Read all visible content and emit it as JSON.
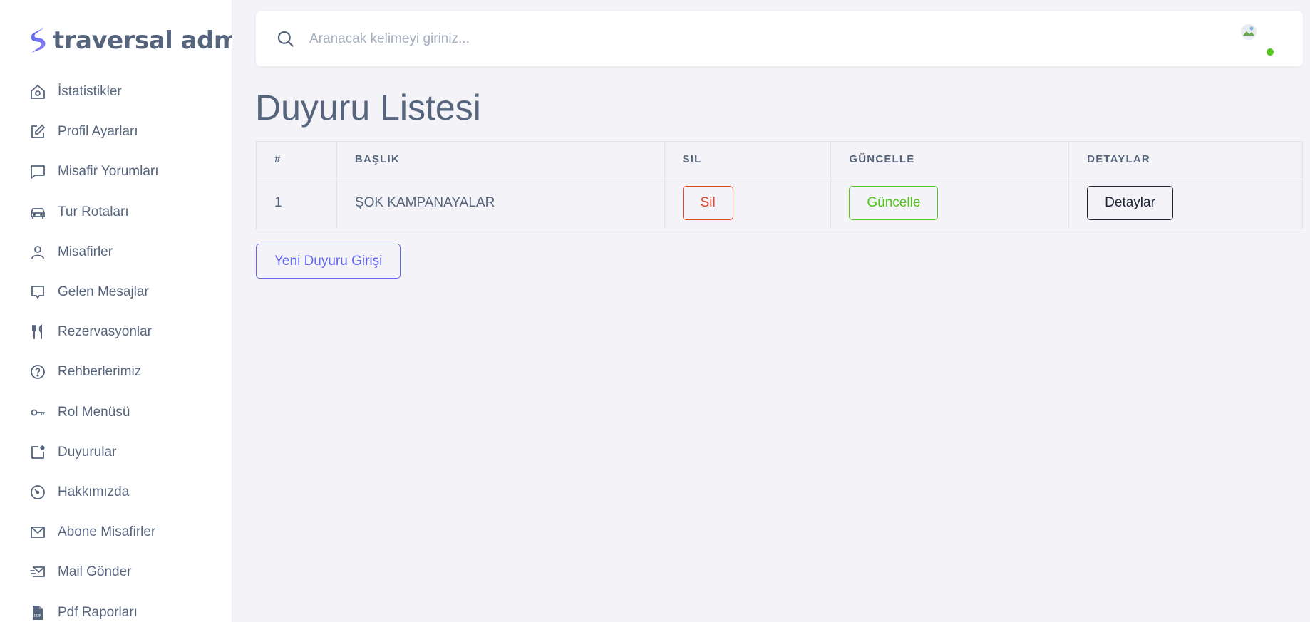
{
  "brand": {
    "name": "traversal admin"
  },
  "sidebar": {
    "items": [
      {
        "label": "İstatistikler",
        "icon": "home-icon"
      },
      {
        "label": "Profil Ayarları",
        "icon": "edit-icon"
      },
      {
        "label": "Misafir Yorumları",
        "icon": "comment-icon"
      },
      {
        "label": "Tur Rotaları",
        "icon": "car-icon"
      },
      {
        "label": "Misafirler",
        "icon": "user-icon"
      },
      {
        "label": "Gelen Mesajlar",
        "icon": "message-icon"
      },
      {
        "label": "Rezervasyonlar",
        "icon": "utensils-icon"
      },
      {
        "label": "Rehberlerimiz",
        "icon": "help-circle-icon"
      },
      {
        "label": "Rol Menüsü",
        "icon": "key-icon"
      },
      {
        "label": "Duyurular",
        "icon": "notification-icon"
      },
      {
        "label": "Hakkımızda",
        "icon": "gauge-icon"
      },
      {
        "label": "Abone Misafirler",
        "icon": "mail-icon"
      },
      {
        "label": "Mail Gönder",
        "icon": "mail-send-icon"
      },
      {
        "label": "Pdf Raporları",
        "icon": "pdf-file-icon"
      }
    ]
  },
  "search": {
    "placeholder": "Aranacak kelimeyi giriniz..."
  },
  "page": {
    "title": "Duyuru Listesi"
  },
  "table": {
    "headers": [
      "#",
      "BAŞLIK",
      "SIL",
      "GÜNCELLE",
      "DETAYLAR"
    ],
    "rows": [
      {
        "id": "1",
        "title": "ŞOK KAMPANAYALAR",
        "delete_label": "Sil",
        "update_label": "Güncelle",
        "details_label": "Detaylar"
      }
    ]
  },
  "actions": {
    "new_label": "Yeni Duyuru Girişi"
  },
  "colors": {
    "text": "#56657d",
    "danger": "#e8432a",
    "success": "#52c41a",
    "primary": "#6366f1",
    "dark": "#1c2332",
    "background": "#f4f4f8"
  }
}
